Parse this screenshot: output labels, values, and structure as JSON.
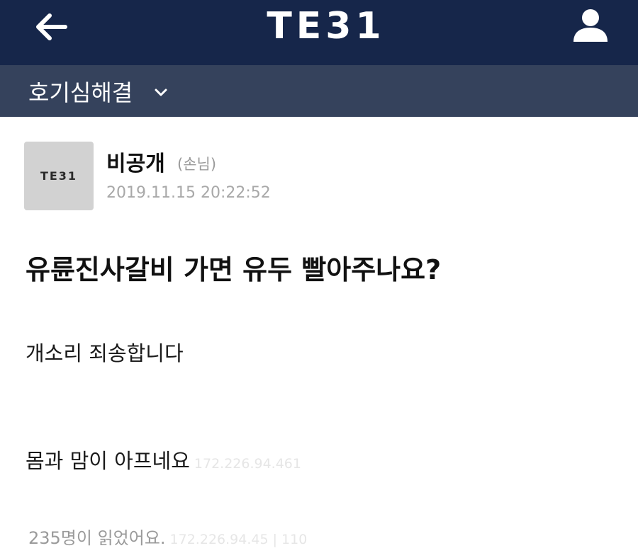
{
  "header": {
    "logo": "TE31",
    "back_icon": "arrow-left-icon",
    "user_icon": "user-icon",
    "bg_color": "#16264a"
  },
  "category_bar": {
    "label": "호기심해결",
    "chevron_icon": "chevron-down-icon",
    "bg_color": "#35425c"
  },
  "author": {
    "avatar_logo": "TE31",
    "name": "비공개",
    "role": "(손님)",
    "date": "2019.11.15 20:22:52"
  },
  "post": {
    "title": "유륜진사갈비 가면 유두 빨아주나요?",
    "body": [
      "개소리 죄송합니다",
      "몸과 맘이 아프네요"
    ],
    "ip": "172.226.94.461",
    "read_count": "235명이 읽었어요.",
    "read_ip": "172.226.94.45 | 110"
  }
}
